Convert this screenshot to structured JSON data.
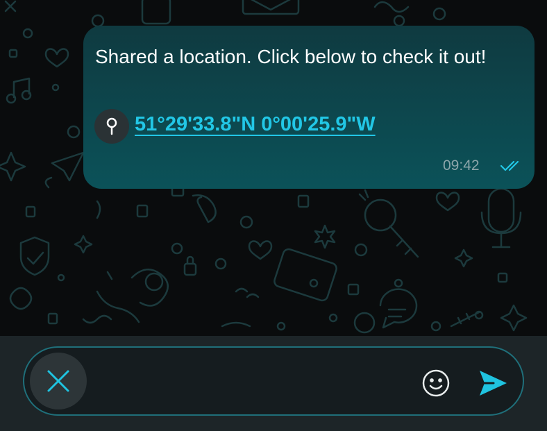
{
  "message": {
    "text": "Shared a location. Click below to check it out!",
    "location_link": "51°29'33.8\"N 0°00'25.9\"W",
    "time": "09:42",
    "status": "read",
    "pin_icon": "map-pin-icon",
    "status_icon": "double-check-icon"
  },
  "composer": {
    "placeholder": "",
    "value": "",
    "close_icon": "close-icon",
    "emoji_icon": "emoji-icon",
    "send_icon": "send-icon"
  },
  "colors": {
    "bubble": "#0f3a40",
    "link": "#22c7e6",
    "accent": "#1fc3e0",
    "background": "#0a0c0d",
    "composer_bar": "#1d2528"
  }
}
